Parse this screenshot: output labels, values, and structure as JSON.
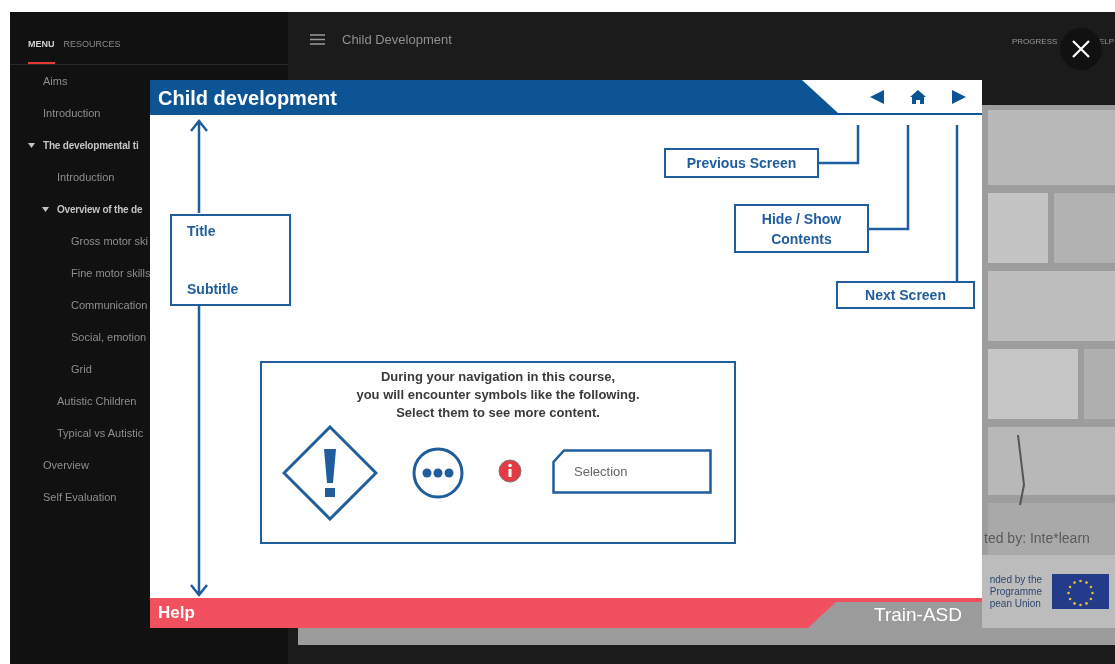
{
  "sidebar": {
    "tabs": [
      {
        "label": "MENU",
        "selected": true
      },
      {
        "label": "RESOURCES",
        "selected": false
      }
    ],
    "items": [
      {
        "label": "Aims"
      },
      {
        "label": "Introduction"
      },
      {
        "label": "The developmental ti",
        "expanded": true,
        "children": [
          {
            "label": "Introduction"
          },
          {
            "label": "Overview of the de",
            "expanded": true,
            "children": [
              {
                "label": "Gross motor ski"
              },
              {
                "label": "Fine motor skills"
              },
              {
                "label": "Communication"
              },
              {
                "label": "Social, emotion"
              },
              {
                "label": "Grid"
              }
            ]
          },
          {
            "label": "Autistic Children"
          },
          {
            "label": "Typical vs Autistic"
          }
        ]
      },
      {
        "label": "Overview"
      },
      {
        "label": "Self Evaluation"
      }
    ]
  },
  "header": {
    "title": "Child Development",
    "links": [
      "PROGRESS",
      "ELP"
    ]
  },
  "background": {
    "photo_caption": "ted by: Inte*learn",
    "funding_lines": [
      "nded by the",
      "Programme",
      "pean Union"
    ]
  },
  "dialog": {
    "title": "Child development",
    "nav": [
      {
        "kind": "prev"
      },
      {
        "kind": "home"
      },
      {
        "kind": "next"
      }
    ],
    "annotations": [
      {
        "kind": "title-box",
        "lines": [
          "Title",
          "Subtitle"
        ]
      },
      {
        "kind": "prev",
        "text": "Previous Screen"
      },
      {
        "kind": "home",
        "text": "Hide / Show Contents"
      },
      {
        "kind": "next",
        "text": "Next Screen"
      }
    ],
    "info": {
      "lines": [
        "During your navigation in this course,",
        "you will encounter symbols like the following.",
        "Select them to see more content."
      ],
      "symbols": [
        {
          "kind": "warning"
        },
        {
          "kind": "more"
        },
        {
          "kind": "info"
        },
        {
          "kind": "selection",
          "label": "Selection"
        }
      ]
    },
    "footer_left": "Help",
    "footer_brand": "Train-ASD"
  }
}
